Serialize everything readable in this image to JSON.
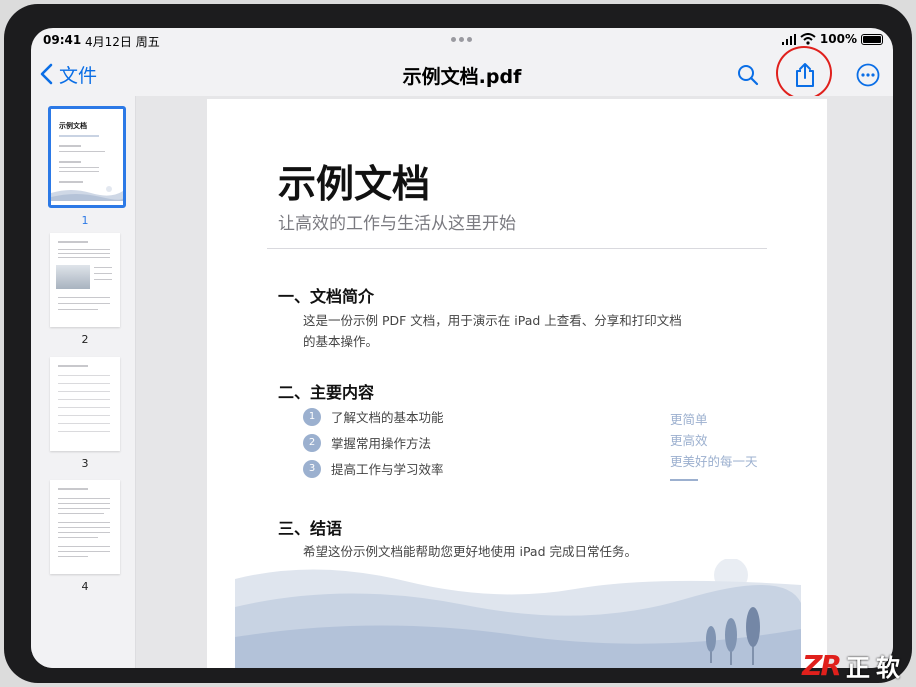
{
  "status": {
    "time": "09:41",
    "date": "4月12日 周五",
    "battery": "100%"
  },
  "nav": {
    "back_label": "文件",
    "title": "示例文档.pdf",
    "icons": [
      "search-icon",
      "share-icon",
      "more-icon"
    ]
  },
  "sidebar": {
    "pages": [
      {
        "label": "1",
        "selected": true
      },
      {
        "label": "2",
        "selected": false
      },
      {
        "label": "3",
        "selected": false
      },
      {
        "label": "4",
        "selected": false
      }
    ]
  },
  "document": {
    "title": "示例文档",
    "subtitle": "让高效的工作与生活从这里开始",
    "section1": {
      "heading": "一、文档简介",
      "text_line1": "这是一份示例 PDF 文档，用于演示在 iPad 上查看、分享和打印文档",
      "text_line2": "的基本操作。"
    },
    "section2": {
      "heading": "二、主要内容",
      "items": [
        {
          "num": "1",
          "text": "了解文档的基本功能"
        },
        {
          "num": "2",
          "text": "掌握常用操作方法"
        },
        {
          "num": "3",
          "text": "提高工作与学习效率"
        }
      ],
      "notes": [
        "更简单",
        "更高效",
        "更美好的每一天"
      ]
    },
    "section3": {
      "heading": "三、结语",
      "text": "希望这份示例文档能帮助您更好地使用 iPad 完成日常任务。"
    }
  },
  "watermark": {
    "logo": "ZR",
    "text": "正软"
  },
  "colors": {
    "accent": "#0a6ee6",
    "highlight_ring": "#e0201c",
    "list_badge": "#9bb0cf"
  }
}
